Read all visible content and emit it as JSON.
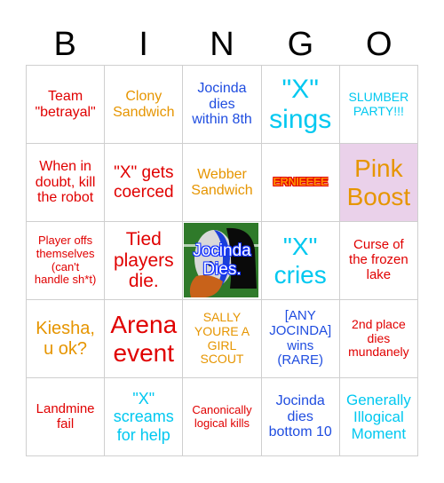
{
  "header": {
    "letters": [
      "B",
      "I",
      "N",
      "G",
      "O"
    ]
  },
  "colors": {
    "red": "#e00000",
    "orange": "#e69500",
    "blue": "#1f4de0",
    "cyan": "#00c8f0",
    "pink_bg": "#ead1ea",
    "grid_line": "#cfcfcf"
  },
  "cells": [
    {
      "text": "Team\n\"betrayal\"",
      "color": "#e00000",
      "size": 16
    },
    {
      "text": "Clony\nSandwich",
      "color": "#e69500",
      "size": 16
    },
    {
      "text": "Jocinda\ndies\nwithin 8th",
      "color": "#1f4de0",
      "size": 16
    },
    {
      "text": "\"X\"\nsings",
      "color": "#00c8f0",
      "size": 30
    },
    {
      "text": "SLUMBER\nPARTY!!!",
      "color": "#00c8f0",
      "size": 14
    },
    {
      "text": "When in\ndoubt, kill\nthe robot",
      "color": "#e00000",
      "size": 16
    },
    {
      "text": "\"X\" gets\ncoerced",
      "color": "#e00000",
      "size": 19
    },
    {
      "text": "Webber\nSandwich",
      "color": "#e69500",
      "size": 16
    },
    {
      "text": "ERNIEEEE",
      "color": "#ff8c00",
      "style": "ernie"
    },
    {
      "text": "Pink\nBoost",
      "color": "#e69500",
      "size": 28,
      "bg": "#ead1ea"
    },
    {
      "text": "Player offs\nthemselves\n(can't\nhandle sh*t)",
      "color": "#e00000",
      "size": 13
    },
    {
      "text": "Tied\nplayers\ndie.",
      "color": "#e00000",
      "size": 21
    },
    {
      "text": "Jocinda\nDies.",
      "free": true
    },
    {
      "text": "\"X\"\ncries",
      "color": "#00c8f0",
      "size": 28
    },
    {
      "text": "Curse of\nthe frozen\nlake",
      "color": "#e00000",
      "size": 15
    },
    {
      "text": "Kiesha,\nu ok?",
      "color": "#e69500",
      "size": 20
    },
    {
      "text": "Arena\nevent",
      "color": "#e00000",
      "size": 28
    },
    {
      "text": "SALLY\nYOURE A\nGIRL\nSCOUT",
      "color": "#e69500",
      "size": 14
    },
    {
      "text": "[ANY\nJOCINDA]\nwins\n(RARE)",
      "color": "#1f4de0",
      "size": 15
    },
    {
      "text": "2nd place\ndies\nmundanely",
      "color": "#e00000",
      "size": 14
    },
    {
      "text": "Landmine\nfail",
      "color": "#e00000",
      "size": 15
    },
    {
      "text": "\"X\"\nscreams\nfor help",
      "color": "#00c8f0",
      "size": 18
    },
    {
      "text": "Canonically\nlogical kills",
      "color": "#e00000",
      "size": 13
    },
    {
      "text": "Jocinda\ndies\nbottom 10",
      "color": "#1f4de0",
      "size": 16
    },
    {
      "text": "Generally\nIllogical\nMoment",
      "color": "#00c8f0",
      "size": 17
    }
  ],
  "free_space_image": {
    "description": "cartoon duck character with black hair on green field",
    "icon": "free-space-image"
  }
}
